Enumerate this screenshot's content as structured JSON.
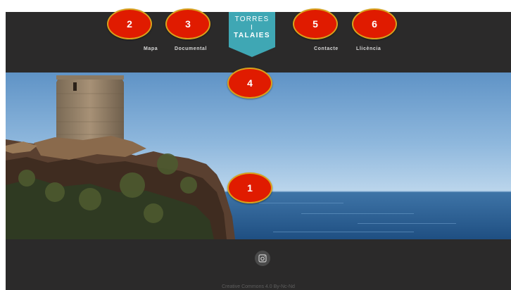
{
  "logo": {
    "line1": "TORRES",
    "line2": "I",
    "line3": "TALAIES",
    "color": "#3fa7b4"
  },
  "nav": {
    "mapa": "Mapa",
    "documental": "Documental",
    "contacte": "Contacte",
    "llicencia": "Llicència"
  },
  "hero": {
    "image": "coastal watchtower on rocky cliff over the sea"
  },
  "footer": {
    "instagram_icon": "instagram-icon",
    "copyright": "Creative Commons 4.0 By-Nc-Nd"
  },
  "markers": [
    "1",
    "2",
    "3",
    "4",
    "5",
    "6"
  ],
  "colors": {
    "background": "#2b2a2a",
    "marker_fill": "#e01b00",
    "marker_border": "#d8a21c"
  }
}
